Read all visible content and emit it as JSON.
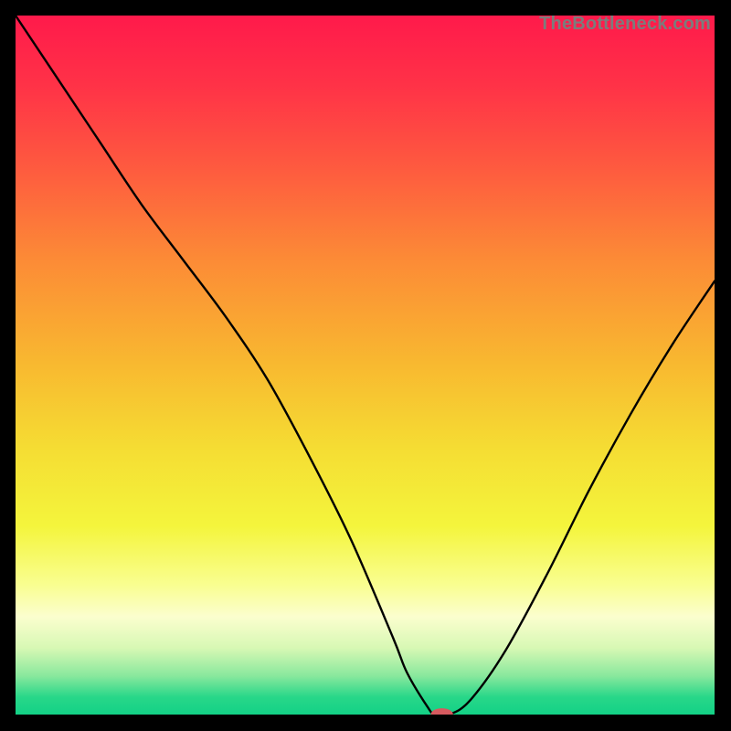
{
  "watermark": "TheBottleneck.com",
  "chart_data": {
    "type": "line",
    "title": "",
    "xlabel": "",
    "ylabel": "",
    "xlim": [
      0,
      100
    ],
    "ylim": [
      0,
      100
    ],
    "grid": false,
    "legend": false,
    "background_gradient": {
      "stops": [
        {
          "offset": 0.0,
          "color": "#ff1a4b"
        },
        {
          "offset": 0.1,
          "color": "#ff3247"
        },
        {
          "offset": 0.22,
          "color": "#fe5b3f"
        },
        {
          "offset": 0.35,
          "color": "#fc8b36"
        },
        {
          "offset": 0.5,
          "color": "#f8b930"
        },
        {
          "offset": 0.62,
          "color": "#f5dd33"
        },
        {
          "offset": 0.73,
          "color": "#f4f53c"
        },
        {
          "offset": 0.815,
          "color": "#f9fe91"
        },
        {
          "offset": 0.86,
          "color": "#fbfece"
        },
        {
          "offset": 0.905,
          "color": "#d7f8b4"
        },
        {
          "offset": 0.945,
          "color": "#88e89d"
        },
        {
          "offset": 0.975,
          "color": "#28d789"
        },
        {
          "offset": 1.0,
          "color": "#13d186"
        }
      ]
    },
    "series": [
      {
        "name": "bottleneck-curve",
        "color": "#000000",
        "x": [
          0,
          6,
          12,
          18,
          24,
          30,
          36,
          42,
          48,
          54,
          56,
          59,
          60,
          62,
          65,
          70,
          76,
          82,
          88,
          94,
          100
        ],
        "values": [
          100,
          91,
          82,
          73,
          65,
          57,
          48,
          37,
          25,
          11,
          6,
          1,
          0,
          0,
          2,
          9,
          20,
          32,
          43,
          53,
          62
        ]
      }
    ],
    "marker": {
      "name": "optimal-point",
      "x": 61,
      "y": 0,
      "color": "#d65a5f",
      "rx": 1.6,
      "ry": 0.9
    }
  }
}
